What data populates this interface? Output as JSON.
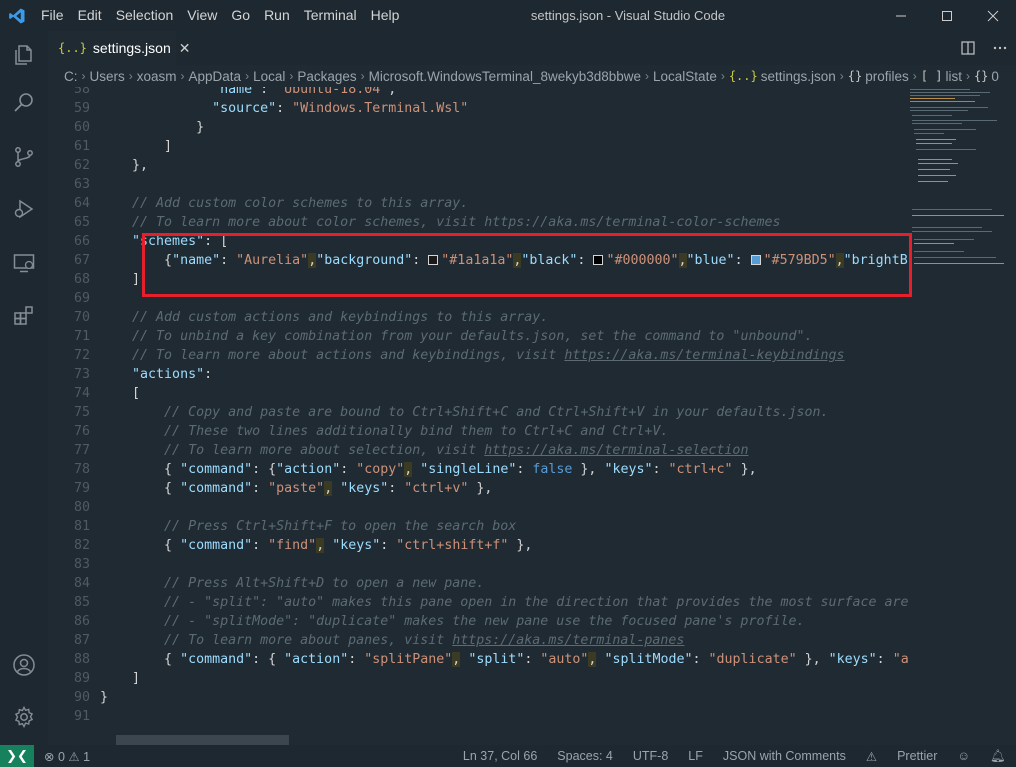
{
  "window": {
    "title": "settings.json - Visual Studio Code"
  },
  "menu": [
    "File",
    "Edit",
    "Selection",
    "View",
    "Go",
    "Run",
    "Terminal",
    "Help"
  ],
  "tab": {
    "icon": "{..}",
    "label": "settings.json",
    "close": "✕"
  },
  "breadcrumb": {
    "parts": [
      "C:",
      "Users",
      "xoasm",
      "AppData",
      "Local",
      "Packages",
      "Microsoft.WindowsTerminal_8wekyb3d8bbwe",
      "LocalState"
    ],
    "file_icon": "{..}",
    "file": "settings.json",
    "obj_icon": "{}",
    "profiles": "profiles",
    "arr_icon": "[ ]",
    "list": "list",
    "obj2_icon": "{}",
    "index": "0"
  },
  "editor": {
    "lines": [
      {
        "n": "58"
      },
      {
        "n": "59"
      },
      {
        "n": "60"
      },
      {
        "n": "61"
      },
      {
        "n": "62"
      },
      {
        "n": "63"
      },
      {
        "n": "64"
      },
      {
        "n": "65"
      },
      {
        "n": "66"
      },
      {
        "n": "67"
      },
      {
        "n": "68"
      },
      {
        "n": "69"
      },
      {
        "n": "70"
      },
      {
        "n": "71"
      },
      {
        "n": "72"
      },
      {
        "n": "73"
      },
      {
        "n": "74"
      },
      {
        "n": "75"
      },
      {
        "n": "76"
      },
      {
        "n": "77"
      },
      {
        "n": "78"
      },
      {
        "n": "79"
      },
      {
        "n": "80"
      },
      {
        "n": "81"
      },
      {
        "n": "82"
      },
      {
        "n": "83"
      },
      {
        "n": "84"
      },
      {
        "n": "85"
      },
      {
        "n": "86"
      },
      {
        "n": "87"
      },
      {
        "n": "88"
      },
      {
        "n": "89"
      },
      {
        "n": "90"
      },
      {
        "n": "91"
      }
    ],
    "t": {
      "l58_key": "\"name\"",
      "l58_val": "\"Ubuntu-18.04\"",
      "l59_key": "\"source\"",
      "l59_val": "\"Windows.Terminal.Wsl\"",
      "l64": "// Add custom color schemes to this array.",
      "l65": "// To learn more about color schemes, visit https://aka.ms/terminal-color-schemes",
      "l66_key": "\"schemes\"",
      "l67_k1": "\"name\"",
      "l67_v1": "\"Aurelia\"",
      "l67_k2": "\"background\"",
      "l67_v2": "\"#1a1a1a\"",
      "l67_k3": "\"black\"",
      "l67_v3": "\"#000000\"",
      "l67_k4": "\"blue\"",
      "l67_v4": "\"#579BD5\"",
      "l67_k5": "\"brightB",
      "l70": "// Add custom actions and keybindings to this array.",
      "l71": "// To unbind a key combination from your defaults.json, set the command to \"unbound\".",
      "l72a": "// To learn more about actions and keybindings, visit ",
      "l72b": "https://aka.ms/terminal-keybindings",
      "l73_key": "\"actions\"",
      "l75": "// Copy and paste are bound to Ctrl+Shift+C and Ctrl+Shift+V in your defaults.json.",
      "l76": "// These two lines additionally bind them to Ctrl+C and Ctrl+V.",
      "l77a": "// To learn more about selection, visit ",
      "l77b": "https://aka.ms/terminal-selection",
      "command": "\"command\"",
      "action": "\"action\"",
      "copy": "\"copy\"",
      "singleLine": "\"singleLine\"",
      "false": "false",
      "keys": "\"keys\"",
      "ctrlc": "\"ctrl+c\"",
      "paste": "\"paste\"",
      "ctrlv": "\"ctrl+v\"",
      "l81": "// Press Ctrl+Shift+F to open the search box",
      "find": "\"find\"",
      "ctrlshiftf": "\"ctrl+shift+f\"",
      "l84": "// Press Alt+Shift+D to open a new pane.",
      "l85": "// - \"split\": \"auto\" makes this pane open in the direction that provides the most surface area",
      "l86": "// - \"splitMode\": \"duplicate\" makes the new pane use the focused pane's profile.",
      "l87a": "// To learn more about panes, visit ",
      "l87b": "https://aka.ms/terminal-panes",
      "splitPane": "\"splitPane\"",
      "split": "\"split\"",
      "auto": "\"auto\"",
      "splitMode": "\"splitMode\"",
      "duplicate": "\"duplicate\"",
      "al": "\"al"
    }
  },
  "swatches": {
    "background": "#1a1a1a",
    "black": "#000000",
    "blue": "#579BD5"
  },
  "statusbar": {
    "errors": "0",
    "warnings": "1",
    "position": "Ln 37, Col 66",
    "spaces": "Spaces: 4",
    "encoding": "UTF-8",
    "eol": "LF",
    "language": "JSON with Comments",
    "prettier": "Prettier"
  }
}
